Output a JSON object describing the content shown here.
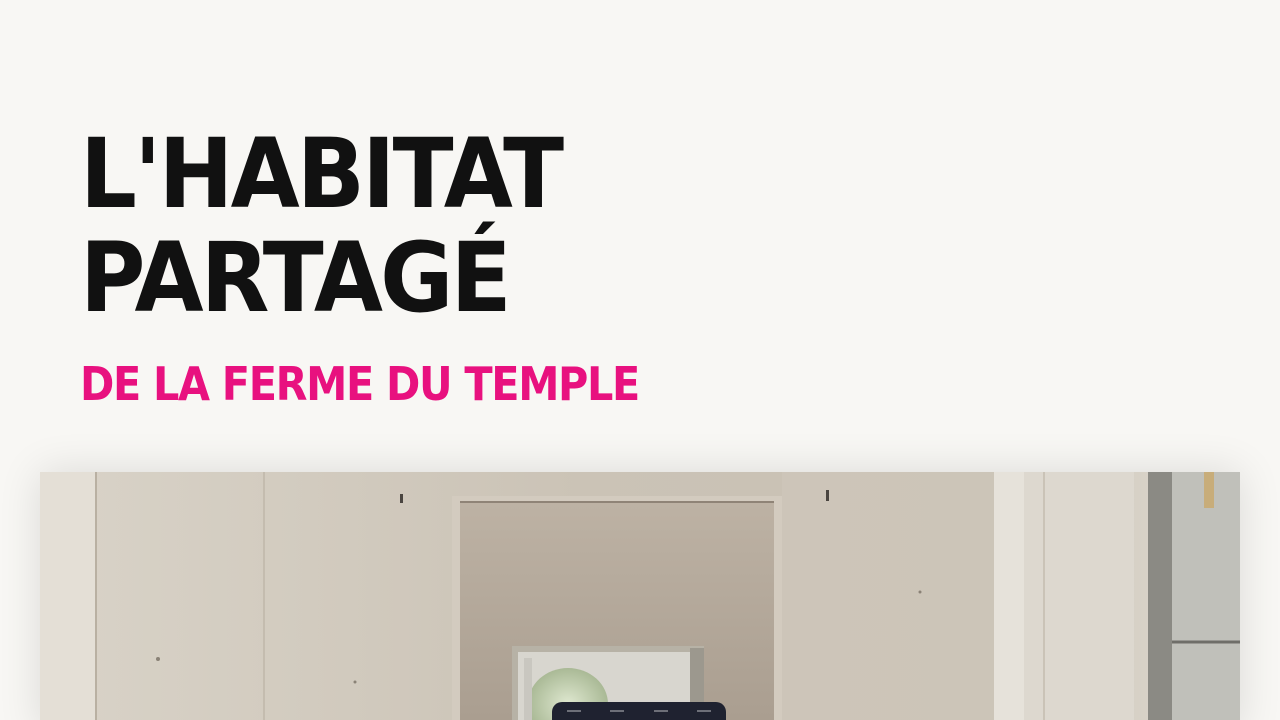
{
  "hero": {
    "title_line1": "L'HABITAT",
    "title_line2": "PARTAGÉ",
    "subtitle": "DE LA FERME DU TEMPLE"
  },
  "colors": {
    "background": "#f8f7f4",
    "title": "#111111",
    "accent": "#e8117f",
    "widget": "#1f2230"
  },
  "photo": {
    "icon": "interior-photo"
  },
  "widget": {
    "icon": "media-controls-icon"
  }
}
